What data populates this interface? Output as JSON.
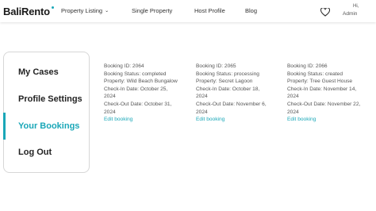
{
  "header": {
    "logo": "BaliRento",
    "nav": [
      {
        "label": "Property Listing",
        "has_dropdown": true
      },
      {
        "label": "Single Property"
      },
      {
        "label": "Host Profile"
      },
      {
        "label": "Blog"
      }
    ],
    "greeting": "Hi,",
    "user": "Admin",
    "icons": {
      "wishlist": "heart-icon",
      "dropdown": "chevron-down-icon"
    }
  },
  "sidebar": {
    "items": [
      {
        "label": "My Cases"
      },
      {
        "label": "Profile Settings"
      },
      {
        "label": "Your Bookings",
        "active": true
      },
      {
        "label": "Log Out"
      }
    ]
  },
  "bookings": [
    {
      "id": "Booking ID: 2064",
      "status": "Booking Status: completed",
      "property": "Property: Wild Beach Bungalow",
      "checkin_1": "Check-In Date: October 25,",
      "checkin_2": "2024",
      "checkout_1": "Check-Out Date: October 31,",
      "checkout_2": "2024",
      "edit": "Edit booking"
    },
    {
      "id": "Booking ID: 2065",
      "status": "Booking Status: processing",
      "property": "Property: Secret Lagoon",
      "checkin_1": "Check-In Date: October 18,",
      "checkin_2": "2024",
      "checkout_1": "Check-Out Date: November 6,",
      "checkout_2": "2024",
      "edit": "Edit booking"
    },
    {
      "id": "Booking ID: 2066",
      "status": "Booking Status: created",
      "property": "Property: Tree Guest House",
      "checkin_1": "Check-In Date: November 14,",
      "checkin_2": "2024",
      "checkout_1": "Check-Out Date: November 22,",
      "checkout_2": "2024",
      "edit": "Edit booking"
    }
  ],
  "colors": {
    "accent": "#1aa7b8",
    "text": "#555555",
    "heading": "#222222"
  }
}
